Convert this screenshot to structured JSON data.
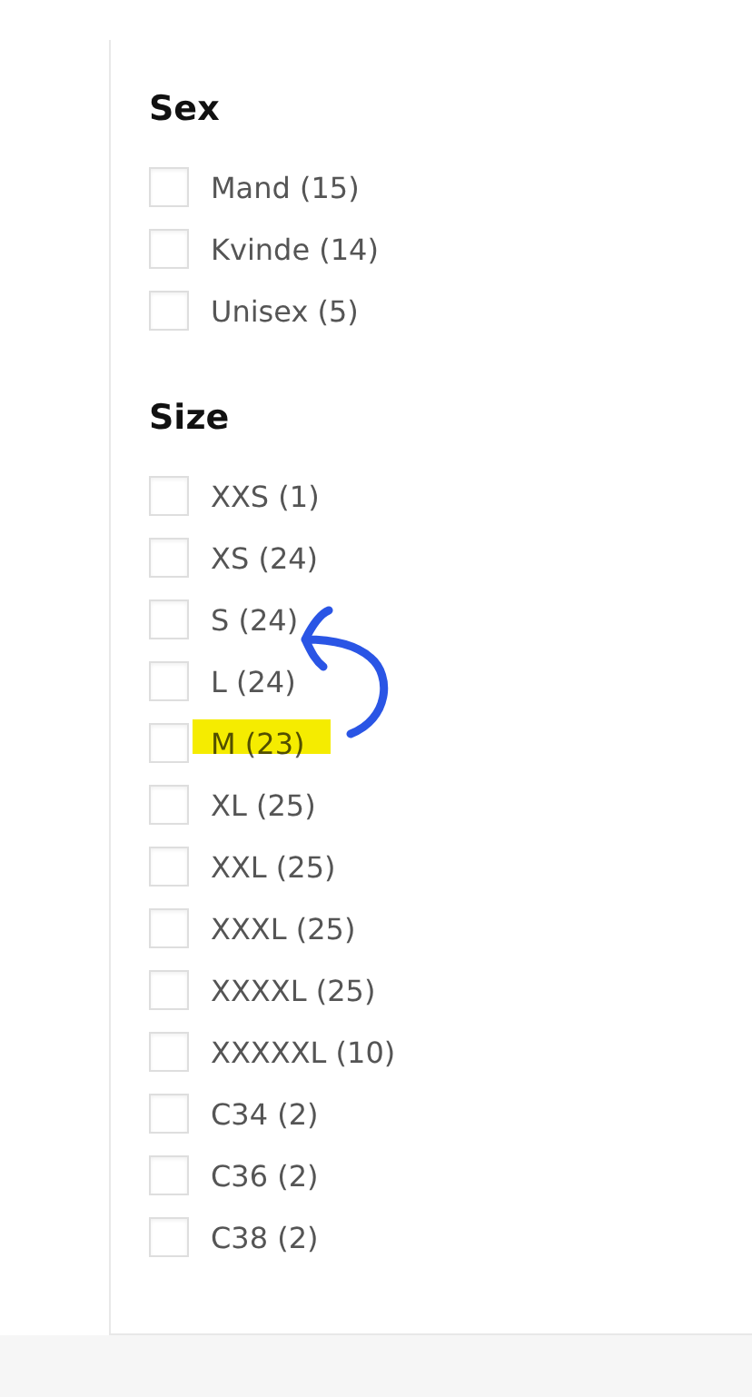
{
  "sections": [
    {
      "title": "Sex",
      "options": [
        {
          "label": "Mand (15)",
          "checked": false
        },
        {
          "label": "Kvinde (14)",
          "checked": false
        },
        {
          "label": "Unisex (5)",
          "checked": false
        }
      ]
    },
    {
      "title": "Size",
      "options": [
        {
          "label": "XXS (1)",
          "checked": false
        },
        {
          "label": "XS (24)",
          "checked": false
        },
        {
          "label": "S (24)",
          "checked": false
        },
        {
          "label": "L (24)",
          "checked": false
        },
        {
          "label": "M (23)",
          "checked": false
        },
        {
          "label": "XL (25)",
          "checked": false
        },
        {
          "label": "XXL (25)",
          "checked": false
        },
        {
          "label": "XXXL (25)",
          "checked": false
        },
        {
          "label": "XXXXL (25)",
          "checked": false
        },
        {
          "label": "XXXXXL (10)",
          "checked": false
        },
        {
          "label": "C34 (2)",
          "checked": false
        },
        {
          "label": "C36 (2)",
          "checked": false
        },
        {
          "label": "C38 (2)",
          "checked": false
        }
      ]
    }
  ]
}
